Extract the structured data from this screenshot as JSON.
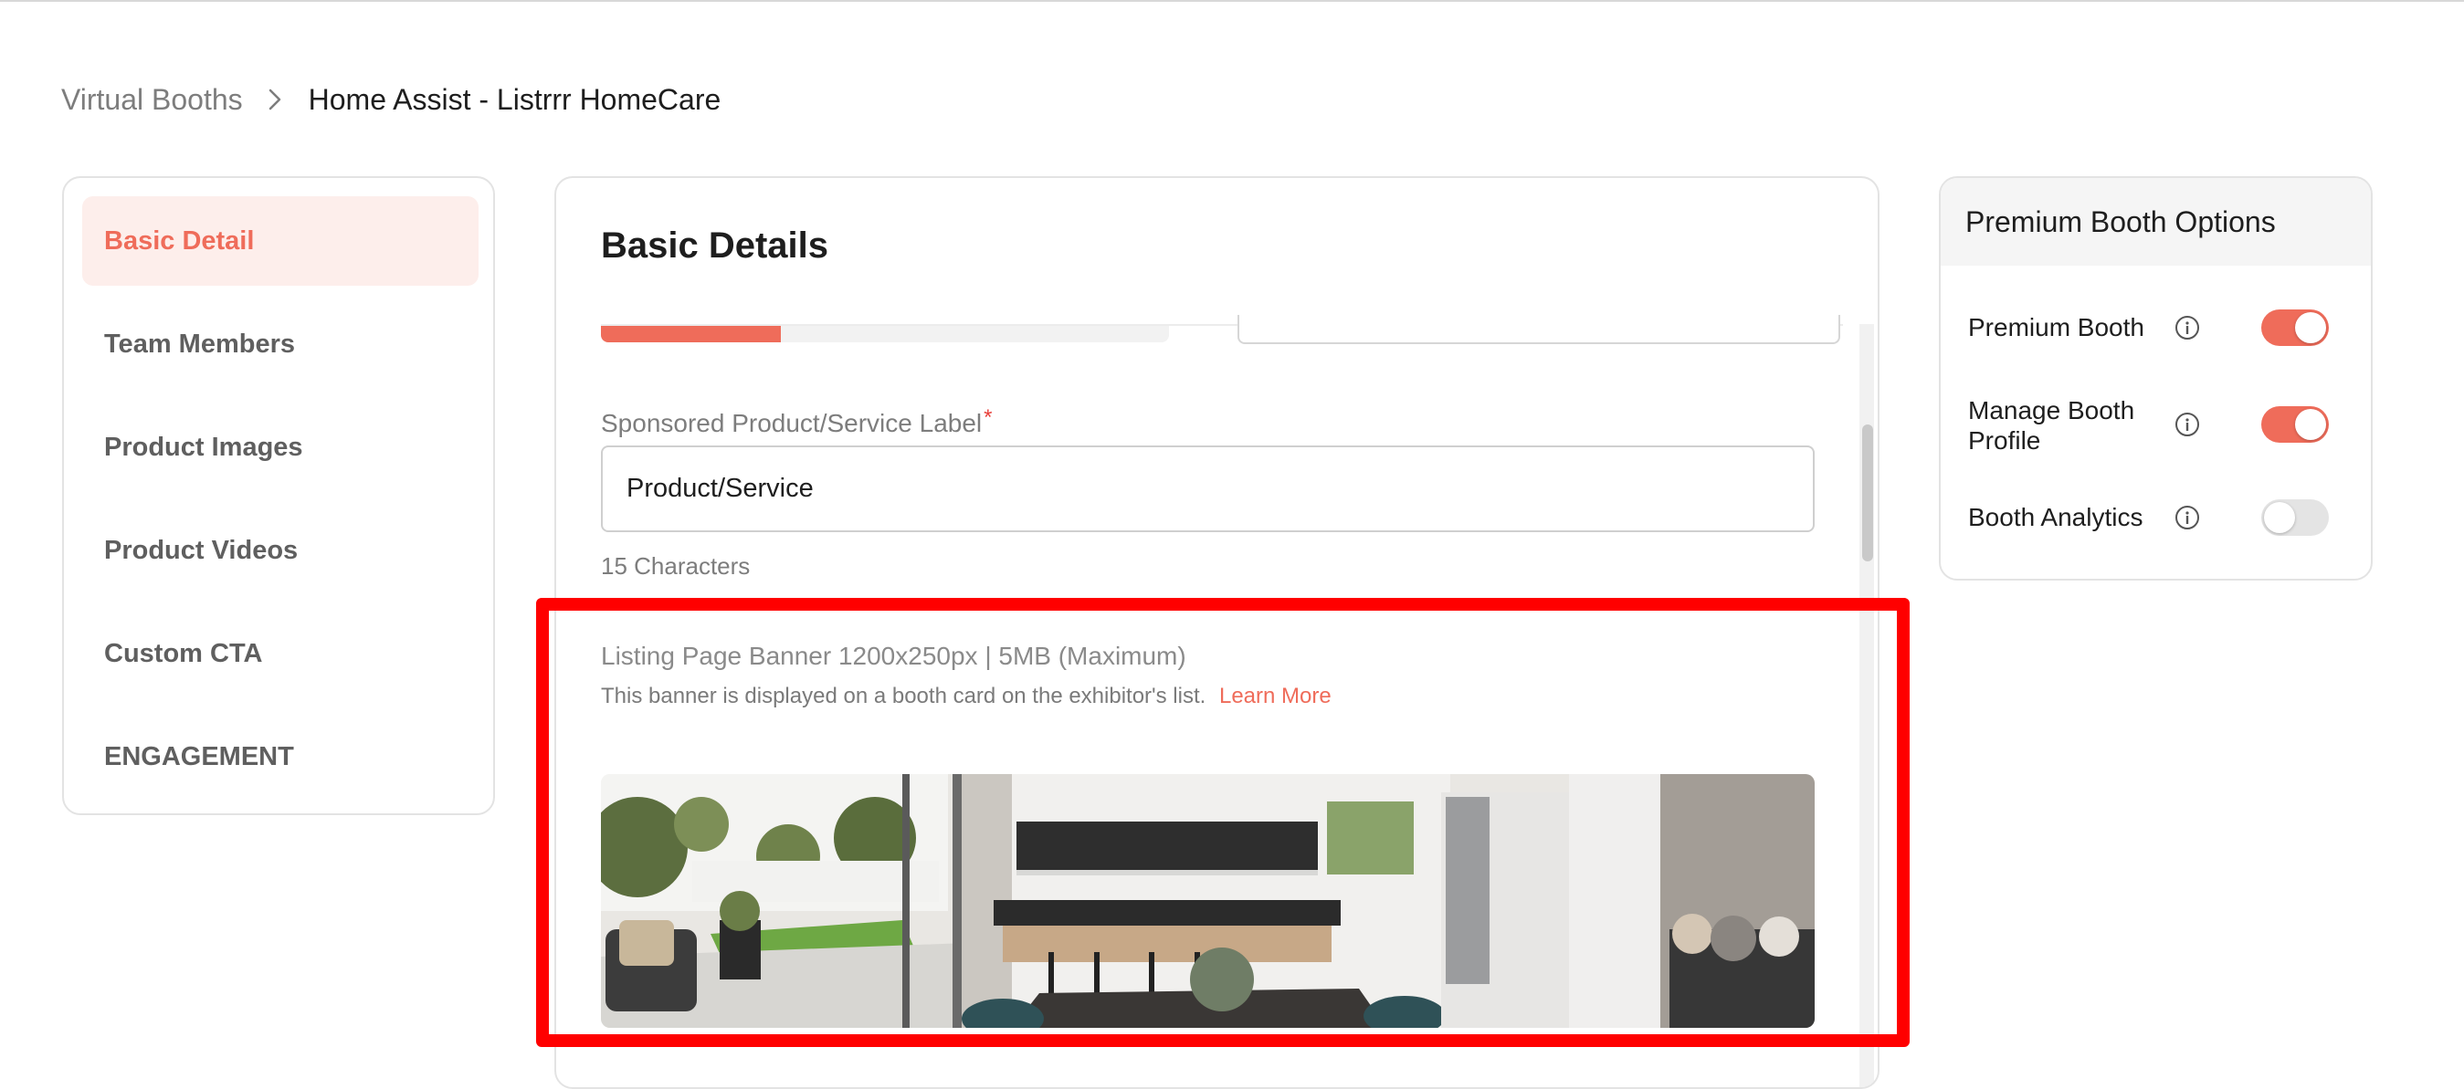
{
  "breadcrumb": {
    "root": "Virtual Booths",
    "current": "Home Assist - Listrrr HomeCare"
  },
  "sidebar": {
    "items": [
      {
        "label": "Basic Detail",
        "active": true
      },
      {
        "label": "Team Members",
        "active": false
      },
      {
        "label": "Product Images",
        "active": false
      },
      {
        "label": "Product Videos",
        "active": false
      },
      {
        "label": "Custom CTA",
        "active": false
      },
      {
        "label": "ENGAGEMENT",
        "active": false
      }
    ]
  },
  "main": {
    "title": "Basic Details",
    "progress_fraction": 0.32,
    "sponsored_label": {
      "label": "Sponsored Product/Service Label",
      "required_mark": "*",
      "value": "Product/Service",
      "char_count": "15 Characters"
    },
    "banner": {
      "title": "Listing Page Banner 1200x250px | 5MB (Maximum)",
      "description": "This banner is displayed on a booth card on the exhibitor's list.",
      "learn_more": "Learn More"
    }
  },
  "premium": {
    "title": "Premium Booth Options",
    "options": [
      {
        "label": "Premium Booth",
        "enabled": true
      },
      {
        "label": "Manage Booth Profile",
        "enabled": true
      },
      {
        "label": "Booth Analytics",
        "enabled": false
      }
    ]
  },
  "colors": {
    "accent": "#ef6c5a",
    "active_bg": "#fdeeeb",
    "highlight": "#ff0000"
  },
  "icons": {
    "breadcrumb_separator": "chevron-right-icon",
    "option_info": "info-circle-icon"
  }
}
